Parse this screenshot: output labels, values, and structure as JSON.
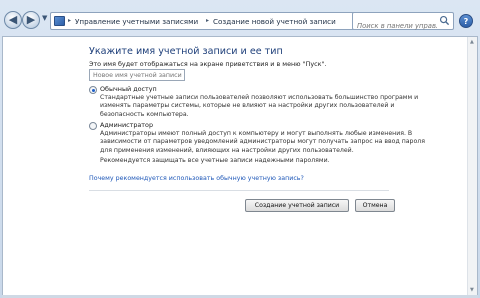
{
  "address_bar": {
    "breadcrumbs": [
      "Управление учетными записями",
      "Создание новой учетной записи"
    ]
  },
  "search": {
    "placeholder": "Поиск в панели управления"
  },
  "heading": "Укажите имя учетной записи и ее тип",
  "description": "Это имя будет отображаться на экране приветствия и в меню \"Пуск\".",
  "name_input": {
    "placeholder": "Новое имя учетной записи",
    "value": ""
  },
  "options": [
    {
      "title": "Обычный доступ",
      "checked": true,
      "lines": [
        "Стандартные учетные записи пользователей позволяют использовать большинство программ и",
        "изменять параметры системы, которые не влияют на настройки других пользователей и",
        "безопасность компьютера."
      ]
    },
    {
      "title": "Администратор",
      "checked": false,
      "lines": [
        "Администраторы имеют полный доступ к компьютеру и могут выполнять любые изменения. В",
        "зависимости от параметров уведомлений администраторы могут получать запрос на ввод пароля",
        "для применения изменений, влияющих на настройки других пользователей."
      ],
      "note": "Рекомендуется защищать все учетные записи надежными паролями."
    }
  ],
  "link": "Почему рекомендуется использовать обычную учетную запись?",
  "buttons": {
    "create": "Создание учетной записи",
    "cancel": "Отмена"
  },
  "icons": {
    "back": "back-arrow-icon",
    "forward": "forward-arrow-icon",
    "refresh": "refresh-icon",
    "search": "search-icon",
    "help": "help-icon",
    "control_panel": "control-panel-icon"
  },
  "colors": {
    "heading": "#1e3f7a",
    "link": "#1f58b8",
    "radio_selected": "#1e5fc8"
  }
}
